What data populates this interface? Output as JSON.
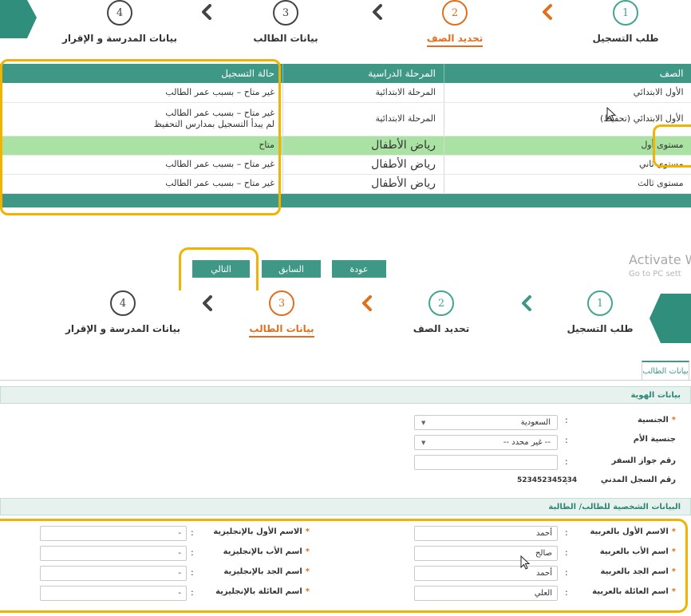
{
  "stepper_top": {
    "steps": [
      {
        "num": "1",
        "label": "طلب التسجيل"
      },
      {
        "num": "2",
        "label": "تحديد الصف"
      },
      {
        "num": "3",
        "label": "بيانات الطالب"
      },
      {
        "num": "4",
        "label": "بيانات المدرسة و الإقرار"
      }
    ]
  },
  "grade_table": {
    "headers": [
      "الصف",
      "المرحلة الدراسية",
      "حالة التسجيل"
    ],
    "rows": [
      {
        "grade": "الأول الابتدائي",
        "stage": "المرحلة الابتدائية",
        "status": "غير متاح – بسبب عمر الطالب",
        "status2": ""
      },
      {
        "grade": "الأول الابتدائي (تحفيظ)",
        "stage": "المرحلة الابتدائية",
        "status": "غير متاح – بسبب عمر الطالب",
        "status2": "لم يبدأ التسجيل بمدارس التحفيظ"
      },
      {
        "grade": "مستوى أول",
        "stage": "رياض الأطفال",
        "status": "متاح",
        "status2": ""
      },
      {
        "grade": "مستوى ثاني",
        "stage": "رياض الأطفال",
        "status": "غير متاح – بسبب عمر الطالب",
        "status2": ""
      },
      {
        "grade": "مستوى ثالث",
        "stage": "رياض الأطفال",
        "status": "غير متاح – بسبب عمر الطالب",
        "status2": ""
      }
    ]
  },
  "buttons": {
    "next": "التالي",
    "previous": "السابق",
    "back": "عودة"
  },
  "watermark": {
    "title": "Activate W",
    "subtitle": "Go to PC sett"
  },
  "stepper_bottom": {
    "steps": [
      {
        "num": "1",
        "label": "طلب التسجيل"
      },
      {
        "num": "2",
        "label": "تحديد الصف"
      },
      {
        "num": "3",
        "label": "بيانات الطالب"
      },
      {
        "num": "4",
        "label": "بيانات المدرسة و الإقرار"
      }
    ]
  },
  "form": {
    "tab_label": "بيانات الطالب",
    "identity_section": "بيانات الهوية",
    "nationality_label": "الجنسية",
    "nationality_value": "السعودية",
    "mother_nationality_label": "جنسية الأم",
    "mother_nationality_value": "-- غير محدد --",
    "passport_label": "رقم جواز السفر",
    "passport_value": "",
    "civil_label": "رقم السجل المدني",
    "civil_value": "523452345234",
    "personal_section": "البيانات الشخصية للطالب/ الطالبة",
    "first_ar_label": "الاسم الأول بالعربية",
    "first_ar_value": "أحمد",
    "father_ar_label": "اسم الأب بالعربية",
    "father_ar_value": "صالح",
    "grand_ar_label": "اسم الجد بالعربية",
    "grand_ar_value": "أحمد",
    "family_ar_label": "اسم العائلة بالعربية",
    "family_ar_value": "العلي",
    "first_en_label": "الاسم الأول بالإنجليزية",
    "father_en_label": "اسم الأب بالإنجليزية",
    "grand_en_label": "اسم الجد بالإنجليزية",
    "family_en_label": "اسم العائلة بالإنجليزية",
    "en_value": "-",
    "colon": ":",
    "required_mark": "*"
  },
  "colors": {
    "teal": "#3f9886",
    "orange": "#e0701e",
    "highlight": "#f2b300",
    "available_row": "#a9e2a2"
  },
  "icons": {
    "chevron": "chevron-left-icon",
    "cursor": "mouse-pointer-icon"
  }
}
